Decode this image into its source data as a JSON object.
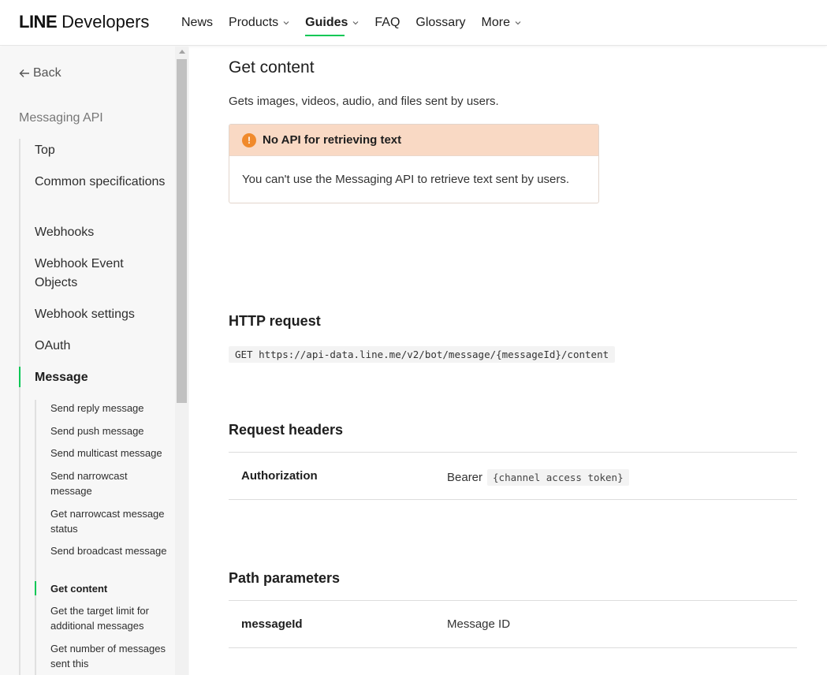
{
  "header": {
    "logo_line": "LINE",
    "logo_dev": "Developers",
    "nav": [
      {
        "label": "News"
      },
      {
        "label": "Products"
      },
      {
        "label": "Guides"
      },
      {
        "label": "FAQ"
      },
      {
        "label": "Glossary"
      },
      {
        "label": "More"
      }
    ]
  },
  "sidebar": {
    "back_label": "Back",
    "section_title": "Messaging API",
    "items": [
      {
        "label": "Top"
      },
      {
        "label": "Common specifications"
      },
      {
        "label": "Webhooks"
      },
      {
        "label": "Webhook Event Objects"
      },
      {
        "label": "Webhook settings"
      },
      {
        "label": "OAuth"
      },
      {
        "label": "Message"
      }
    ],
    "sub_items": [
      {
        "label": "Send reply message"
      },
      {
        "label": "Send push message"
      },
      {
        "label": "Send multicast message"
      },
      {
        "label": "Send narrowcast message"
      },
      {
        "label": "Get narrowcast message status"
      },
      {
        "label": "Send broadcast message"
      },
      {
        "label": "Get content"
      },
      {
        "label": "Get the target limit for additional messages"
      },
      {
        "label": "Get number of messages sent this"
      }
    ]
  },
  "main": {
    "title": "Get content",
    "description": "Gets images, videos, audio, and files sent by users.",
    "notice": {
      "title": "No API for retrieving text",
      "body": "You can't use the Messaging API to retrieve text sent by users."
    },
    "http_request": {
      "heading": "HTTP request",
      "code": "GET https://api-data.line.me/v2/bot/message/{messageId}/content"
    },
    "request_headers": {
      "heading": "Request headers",
      "name": "Authorization",
      "value_prefix": "Bearer",
      "value_code": "{channel access token}"
    },
    "path_parameters": {
      "heading": "Path parameters",
      "name": "messageId",
      "value": "Message ID"
    }
  },
  "colors": {
    "accent": "#06c755",
    "notice_bg": "#f9d9c4",
    "warning_icon": "#f08a2c"
  }
}
